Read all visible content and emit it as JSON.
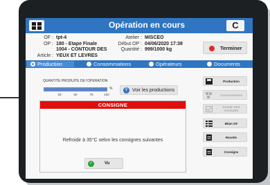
{
  "header": {
    "title": "Opération en cours",
    "menu_icon": "grid-icon",
    "refresh_icon": "refresh-icon",
    "refresh_glyph": "C"
  },
  "info": {
    "of": {
      "label": "OF :",
      "value": "tpt-4"
    },
    "op": {
      "label": "OP :",
      "value": "180 - Etape Finale"
    },
    "product": "1004 - CONTOUR DES",
    "article": {
      "label": "Article :",
      "value": "YEUX ET LEVRES"
    },
    "atelier": {
      "label": "Atelier :",
      "value": "MISCEO"
    },
    "debut": {
      "label": "Début OP :",
      "value": "04/06/2020 17:38"
    },
    "quantite": {
      "label": "Quantité :",
      "value": "999/1000 kg"
    }
  },
  "terminer": {
    "label": "Terminer"
  },
  "tabs": [
    {
      "label": "Production",
      "active": true
    },
    {
      "label": "Consommations",
      "active": false
    },
    {
      "label": "Opérateurs",
      "active": false
    },
    {
      "label": "Documents",
      "active": false
    }
  ],
  "production": {
    "qty_label": "QUANTITE PRODUITE DE l'OPERATION",
    "progress_fraction": 0.999,
    "percent_sign": "%",
    "ticks": [
      "25",
      "50",
      "75",
      "100"
    ],
    "voir_label": "Voir les productions"
  },
  "consigne_dialog": {
    "title": "CONSIGNE",
    "message": "Refroidir à 35°C selon les consignes suivantes",
    "button_label": "Vu"
  },
  "side_buttons": [
    {
      "label": "Production",
      "icon": "save-icon",
      "enabled": true
    },
    {
      "label": "Consommation",
      "icon": "boxes-icon",
      "enabled": false
    },
    {
      "label": "SAISIE DES VALEURS",
      "icon": "checkbox-icon",
      "enabled": false
    },
    {
      "label": "Bilan OF",
      "icon": "list-icon",
      "enabled": true
    },
    {
      "label": "Recette",
      "icon": "doc-icon",
      "enabled": true
    },
    {
      "label": "Consigne",
      "icon": "doc-icon",
      "enabled": true
    }
  ],
  "colors": {
    "accent": "#2f75c2",
    "danger": "#e20d0d",
    "success": "#27a33c"
  }
}
